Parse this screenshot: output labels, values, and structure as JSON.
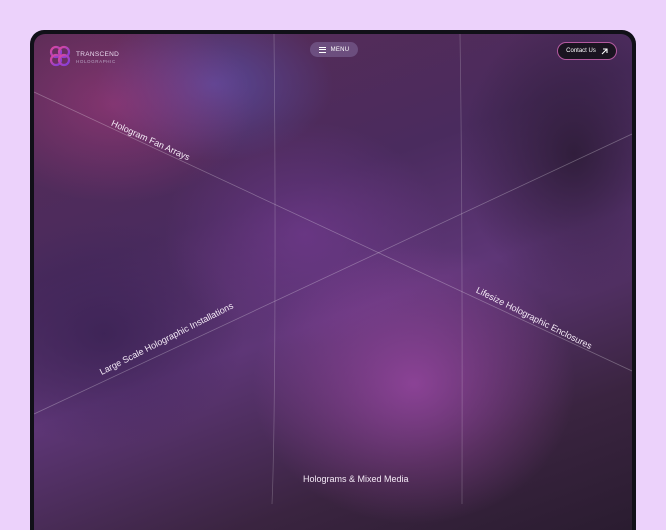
{
  "brand": {
    "name": "TRANSCEND",
    "subtitle": "HOLOGRAPHIC",
    "logo_icon": "clover-logo-icon"
  },
  "nav": {
    "menu_label": "MENU",
    "menu_icon": "hamburger-icon",
    "contact_label": "Contact Us",
    "contact_icon": "arrow-up-right-icon"
  },
  "categories": {
    "fan_arrays": "Hologram Fan Arrays",
    "large_scale": "Large Scale Holographic Installations",
    "lifesize": "Lifesize Holographic Enclosures",
    "mixed_media": "Holograms & Mixed Media"
  },
  "colors": {
    "page_background": "#ecd2fb",
    "device_frame": "#111018",
    "accent_border": "#b45aa0",
    "button_background": "#1a1420"
  }
}
